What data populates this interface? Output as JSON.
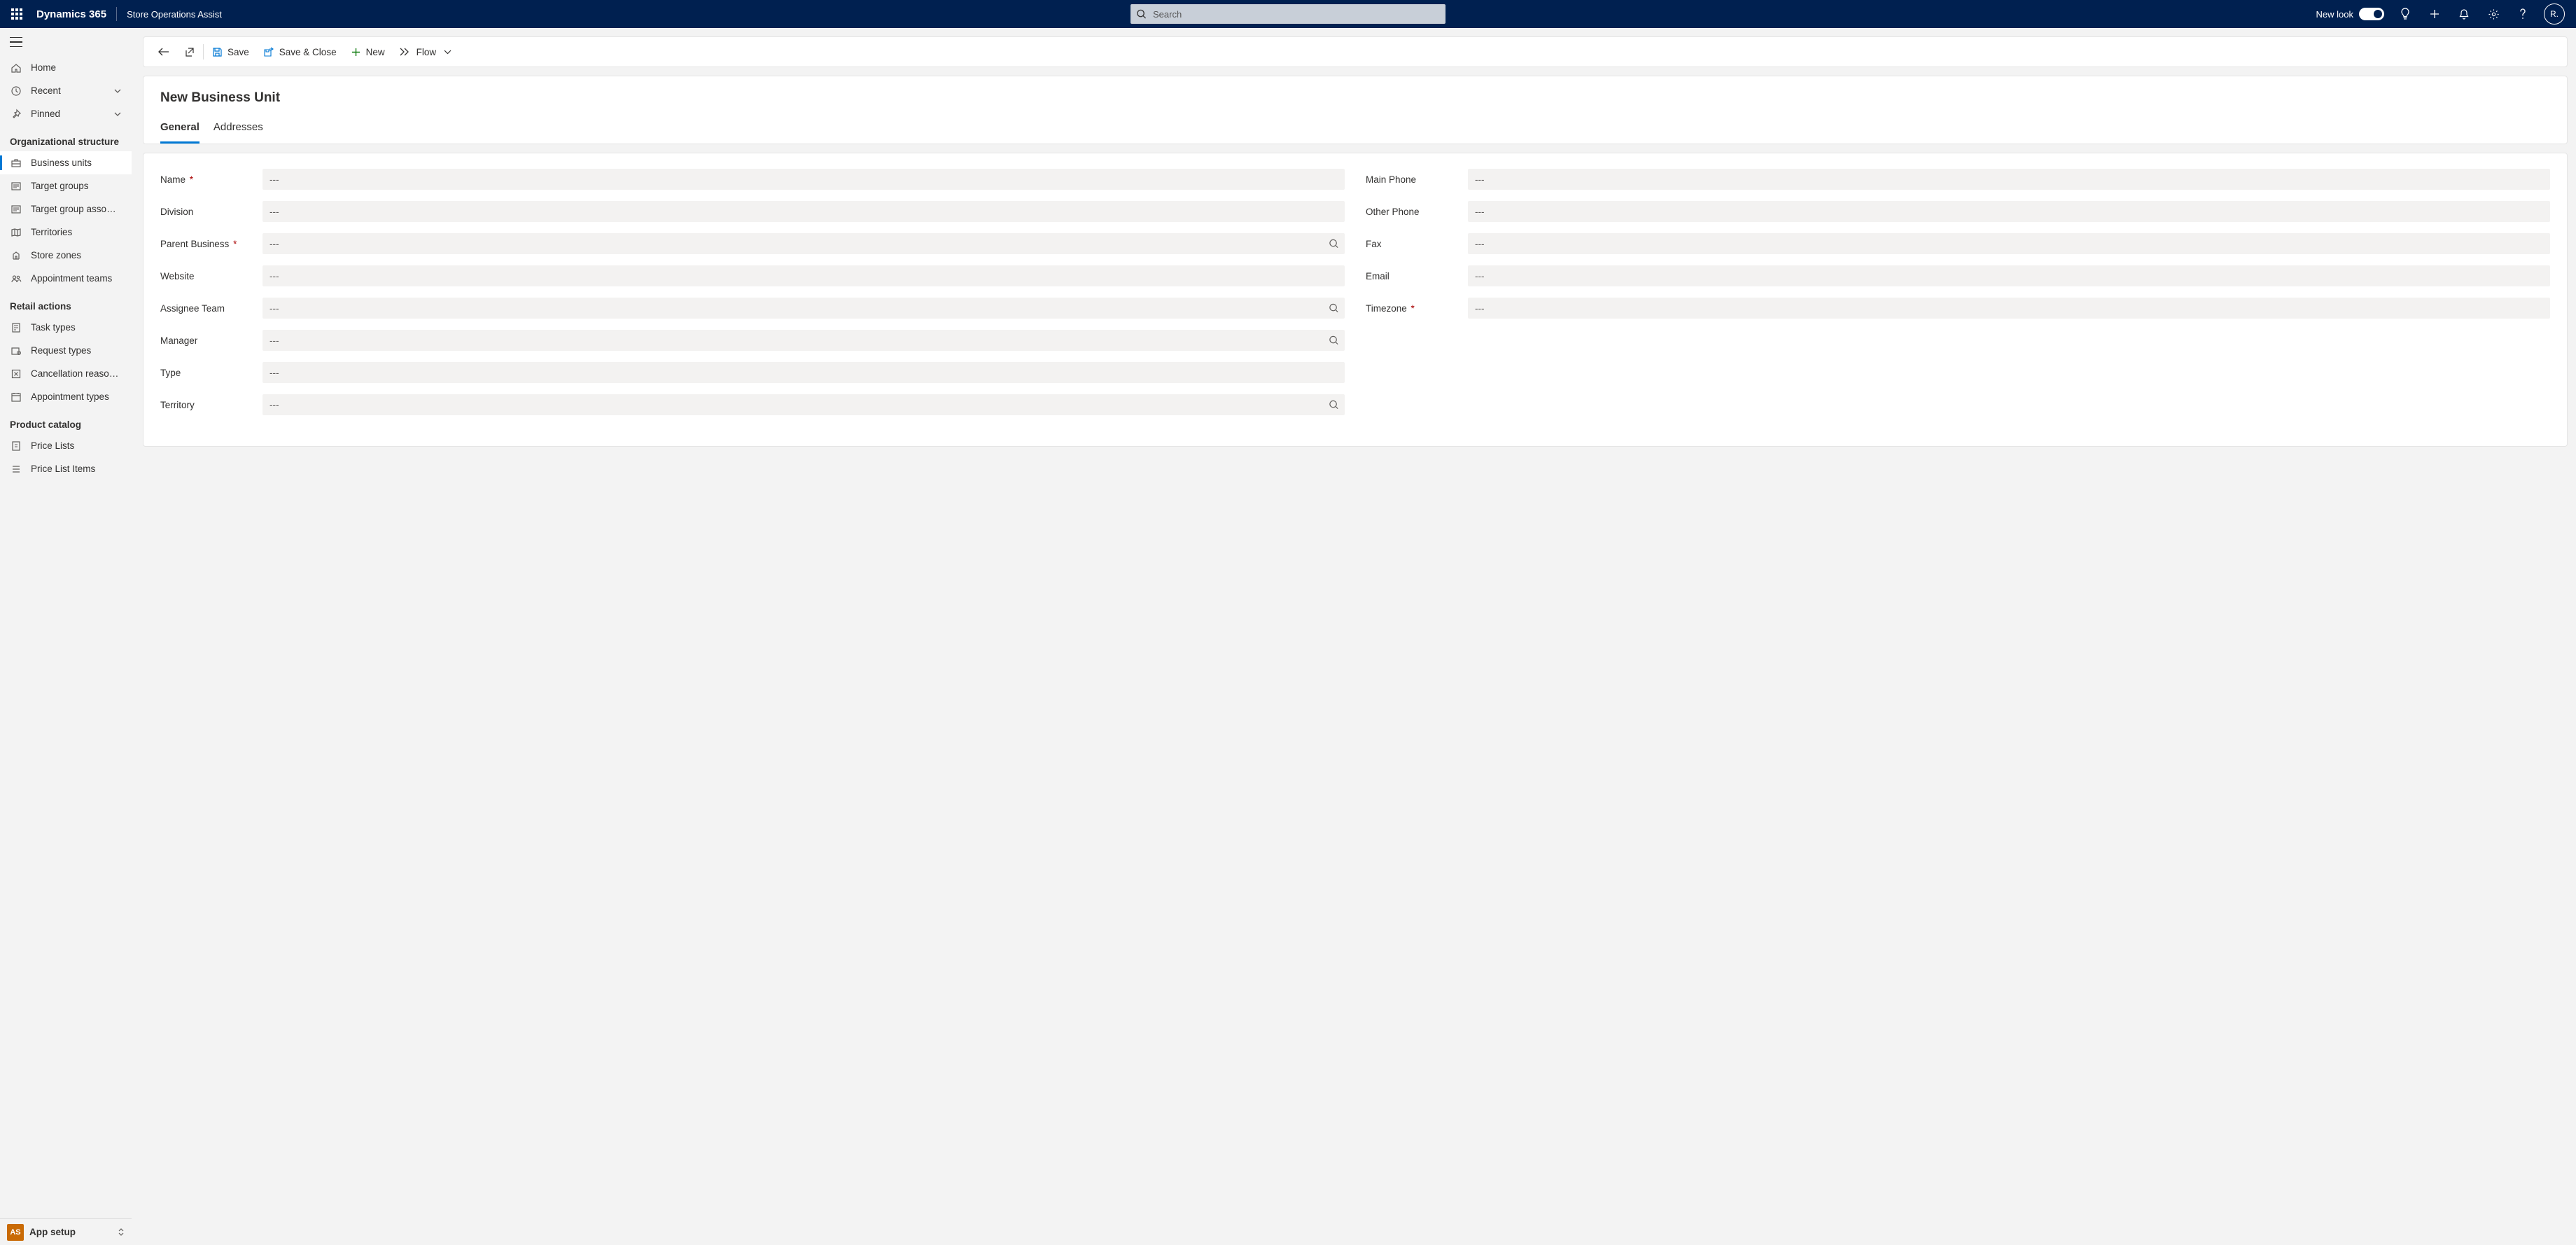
{
  "header": {
    "brand": "Dynamics 365",
    "app_name": "Store Operations Assist",
    "search_placeholder": "Search",
    "new_look_label": "New look",
    "avatar_initial": "R."
  },
  "sidebar": {
    "primary": [
      {
        "label": "Home",
        "icon": "home"
      },
      {
        "label": "Recent",
        "icon": "clock",
        "chevron": true
      },
      {
        "label": "Pinned",
        "icon": "pin",
        "chevron": true
      }
    ],
    "sections": [
      {
        "title": "Organizational structure",
        "items": [
          {
            "label": "Business units",
            "icon": "briefcase",
            "active": true
          },
          {
            "label": "Target groups",
            "icon": "list"
          },
          {
            "label": "Target group asso…",
            "icon": "list"
          },
          {
            "label": "Territories",
            "icon": "map"
          },
          {
            "label": "Store zones",
            "icon": "zone"
          },
          {
            "label": "Appointment teams",
            "icon": "people"
          }
        ]
      },
      {
        "title": "Retail actions",
        "items": [
          {
            "label": "Task types",
            "icon": "task"
          },
          {
            "label": "Request types",
            "icon": "request"
          },
          {
            "label": "Cancellation reaso…",
            "icon": "cancel"
          },
          {
            "label": "Appointment types",
            "icon": "calendar"
          }
        ]
      },
      {
        "title": "Product catalog",
        "items": [
          {
            "label": "Price Lists",
            "icon": "price"
          },
          {
            "label": "Price List Items",
            "icon": "items"
          }
        ]
      }
    ],
    "app_selector": {
      "badge": "AS",
      "label": "App setup"
    }
  },
  "cmdbar": {
    "save": "Save",
    "save_close": "Save & Close",
    "new": "New",
    "flow": "Flow"
  },
  "form": {
    "title": "New Business Unit",
    "tabs": [
      "General",
      "Addresses"
    ],
    "placeholder": "---",
    "left_fields": [
      {
        "label": "Name",
        "required": true,
        "lookup": false
      },
      {
        "label": "Division",
        "required": false,
        "lookup": false
      },
      {
        "label": "Parent Business",
        "required": true,
        "lookup": true
      },
      {
        "label": "Website",
        "required": false,
        "lookup": false
      },
      {
        "label": "Assignee Team",
        "required": false,
        "lookup": true
      },
      {
        "label": "Manager",
        "required": false,
        "lookup": true
      },
      {
        "label": "Type",
        "required": false,
        "lookup": false
      },
      {
        "label": "Territory",
        "required": false,
        "lookup": true
      }
    ],
    "right_fields": [
      {
        "label": "Main Phone",
        "required": false,
        "lookup": false
      },
      {
        "label": "Other Phone",
        "required": false,
        "lookup": false
      },
      {
        "label": "Fax",
        "required": false,
        "lookup": false
      },
      {
        "label": "Email",
        "required": false,
        "lookup": false
      },
      {
        "label": "Timezone",
        "required": true,
        "lookup": false
      }
    ]
  }
}
